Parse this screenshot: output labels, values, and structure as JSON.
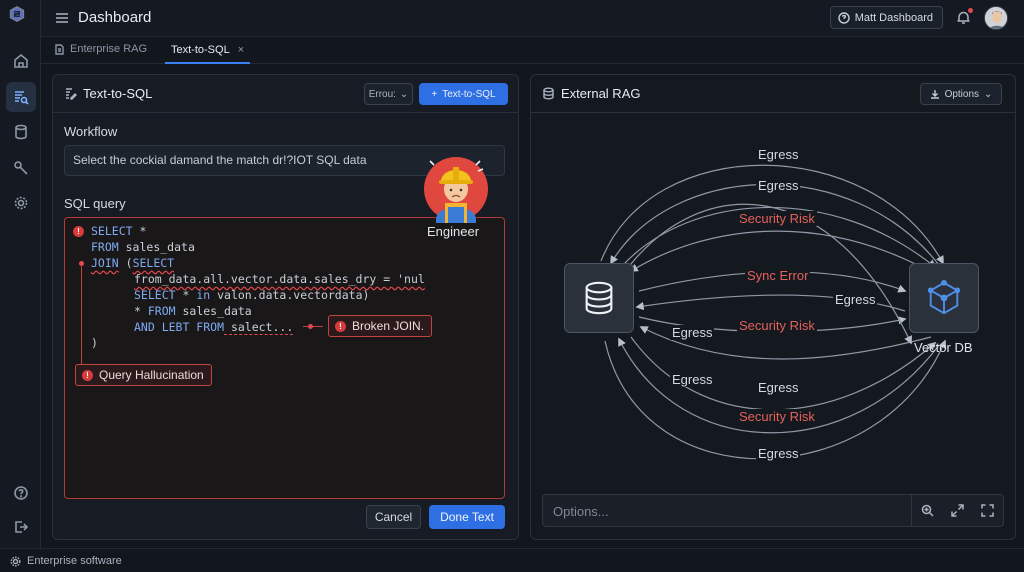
{
  "app": {
    "title": "Dashboard",
    "help_button": "Matt Dashboard",
    "status": "Enterprise software"
  },
  "rail": {
    "items": [
      "home-icon",
      "query-icon",
      "database-icon",
      "tools-icon",
      "settings-icon",
      "help-icon",
      "logout-icon"
    ],
    "active": "query-icon"
  },
  "tabs": {
    "breadcrumb": "Enterprise RAG",
    "active": "Text-to-SQL",
    "close": "×"
  },
  "left_panel": {
    "title": "Text-to-SQL",
    "select_value": "Errou:",
    "primary_button": "Text-to-SQL",
    "workflow_label": "Workflow",
    "workflow_value": "Select the cockial damand the match dr!?IOT SQL data",
    "sql_label": "SQL query",
    "sql": {
      "l1_kw": "SELECT",
      "l1_rest": " *",
      "l2_kw": "FROM",
      "l2_rest": " sales_data",
      "l3_kw": "JOIN",
      "l3_paren": " (",
      "l3_kw2": "SELECT",
      "l4": "from_data.all.vector.data.sales_dry = 'nul",
      "l5_kw": "SELECT",
      "l5_rest": " * ",
      "l5_kw2": "in",
      "l5_rest2": " valon.data.vectordata)",
      "l6_star": "* ",
      "l6_kw": "FROM",
      "l6_rest": " sales_data",
      "l7_kw": "AND LEBT FROM",
      "l7_rest": " salect...",
      "l8": ")"
    },
    "error_broken_join": "Broken JOIN.",
    "error_hallucination": "Query Hallucination",
    "engineer_label": "Engineer",
    "cancel": "Cancel",
    "done": "Done Text"
  },
  "right_panel": {
    "title": "External RAG",
    "options_button": "Options",
    "target_node": "Vector DB",
    "edges": [
      {
        "label": "Egress",
        "kind": "normal"
      },
      {
        "label": "Egress",
        "kind": "normal"
      },
      {
        "label": "Security Risk",
        "kind": "risk"
      },
      {
        "label": "Sync Error",
        "kind": "risk"
      },
      {
        "label": "Egress",
        "kind": "normal"
      },
      {
        "label": "Egress",
        "kind": "normal"
      },
      {
        "label": "Security Risk",
        "kind": "risk"
      },
      {
        "label": "Egress",
        "kind": "normal"
      },
      {
        "label": "Egress",
        "kind": "normal"
      },
      {
        "label": "Security Risk",
        "kind": "risk"
      },
      {
        "label": "Egress",
        "kind": "normal"
      }
    ],
    "input_placeholder": "Options...",
    "tools": [
      "zoom-in-icon",
      "expand-icon",
      "fullscreen-icon"
    ]
  },
  "colors": {
    "accent": "#2f6fe4",
    "risk": "#e5605a",
    "error_border": "#c0443f"
  }
}
